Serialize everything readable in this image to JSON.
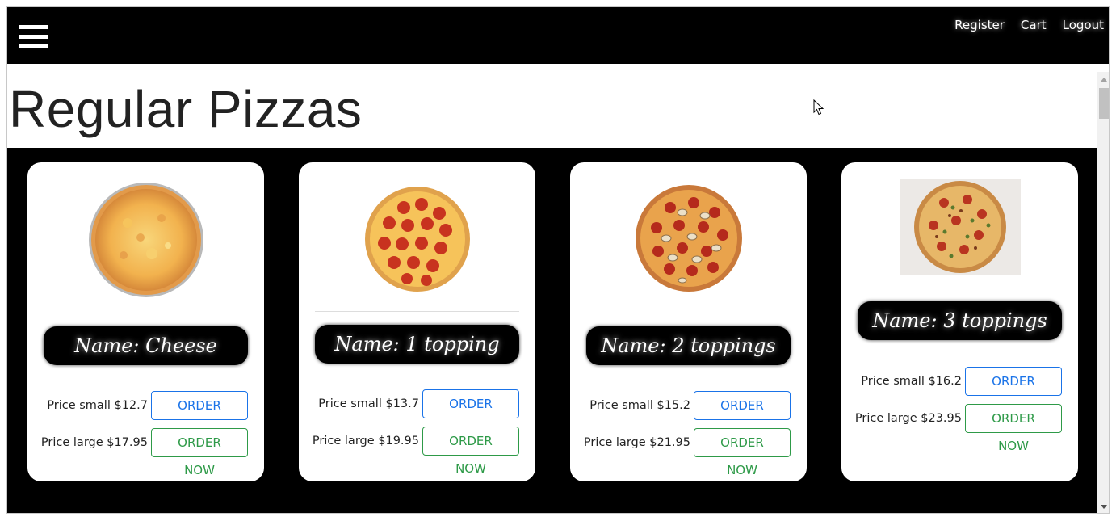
{
  "nav": {
    "links": [
      "Register",
      "Cart",
      "Logout"
    ]
  },
  "page": {
    "title": "Regular Pizzas"
  },
  "products": [
    {
      "name": "Name: Cheese",
      "price_small": "Price small $12.7",
      "price_large": "Price large $17.95",
      "order_small": "ORDER NOW",
      "order_large": "ORDER NOW",
      "image": "cheese-pizza"
    },
    {
      "name": "Name: 1 topping",
      "price_small": "Price small $13.7",
      "price_large": "Price large $19.95",
      "order_small": "ORDER NOW",
      "order_large": "ORDER NOW",
      "image": "pepperoni-pizza"
    },
    {
      "name": "Name: 2 toppings",
      "price_small": "Price small $15.2",
      "price_large": "Price large $21.95",
      "order_small": "ORDER NOW",
      "order_large": "ORDER NOW",
      "image": "pepperoni-mushroom-pizza"
    },
    {
      "name": "Name: 3 toppings",
      "price_small": "Price small $16.2",
      "price_large": "Price large $23.95",
      "order_small": "ORDER NOW",
      "order_large": "ORDER NOW",
      "image": "supreme-pizza"
    }
  ],
  "colors": {
    "navbar_bg": "#000000",
    "order_small_border": "#1a73e8",
    "order_large_border": "#2e9a48"
  },
  "icons": {
    "menu": "hamburger-menu-icon",
    "cursor": "mouse-cursor-icon"
  }
}
